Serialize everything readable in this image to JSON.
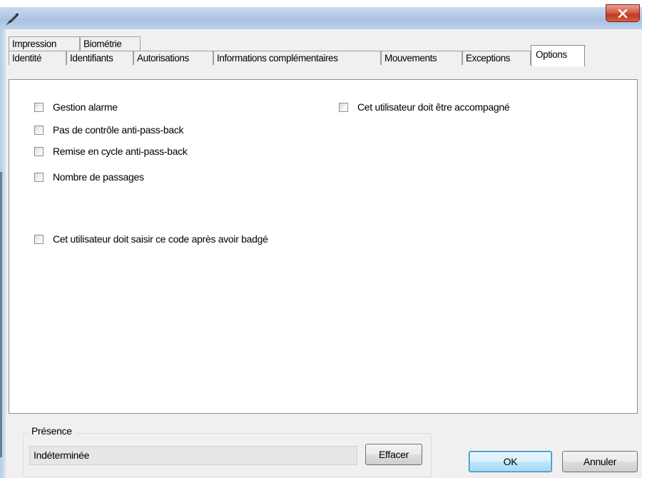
{
  "window": {
    "icon": "pen-icon",
    "close_icon": "close-icon"
  },
  "tabs": {
    "row1": [
      {
        "label": "Impression"
      },
      {
        "label": "Biométrie"
      }
    ],
    "row2": [
      {
        "label": "Identité"
      },
      {
        "label": "Identifiants"
      },
      {
        "label": "Autorisations"
      },
      {
        "label": "Informations complémentaires"
      },
      {
        "label": "Mouvements"
      },
      {
        "label": "Exceptions"
      },
      {
        "label": "Options",
        "active": true
      }
    ]
  },
  "options": {
    "gestion_alarme": {
      "label": "Gestion alarme",
      "checked": false
    },
    "pas_controle": {
      "label": "Pas de contrôle anti-pass-back",
      "checked": false
    },
    "remise_cycle": {
      "label": "Remise en cycle anti-pass-back",
      "checked": false
    },
    "nombre_passages": {
      "label": "Nombre de passages",
      "checked": false
    },
    "saisir_code": {
      "label": "Cet utilisateur doit saisir ce code après avoir badgé",
      "checked": false
    },
    "accompagne": {
      "label": "Cet utilisateur doit être accompagné",
      "checked": false
    }
  },
  "presence": {
    "group_title": "Présence",
    "value": "Indéterminée",
    "clear_button": "Effacer"
  },
  "footer": {
    "ok_button": "OK",
    "cancel_button": "Annuler"
  }
}
